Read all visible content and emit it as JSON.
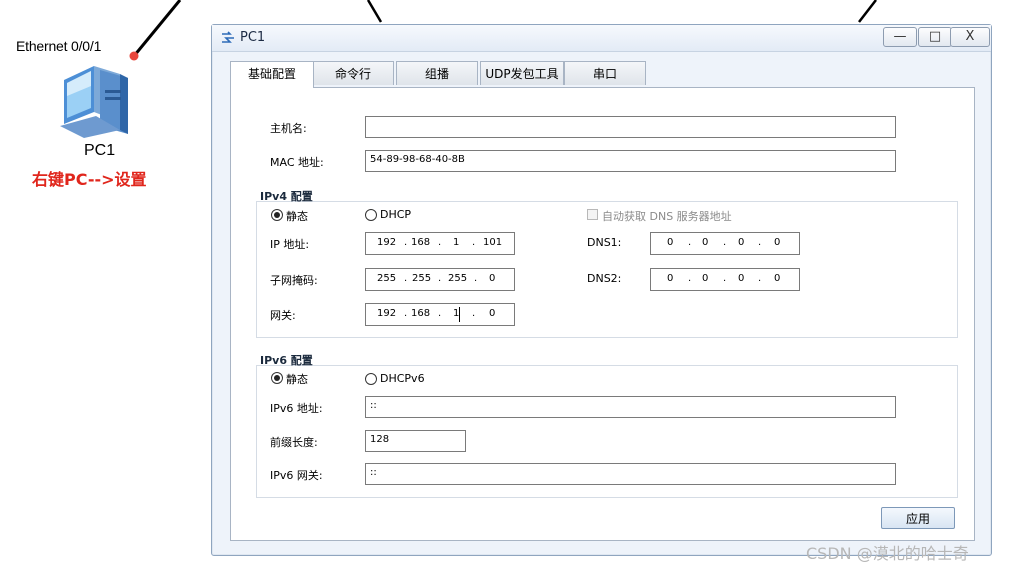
{
  "topology": {
    "port_label": "Ethernet 0/0/1",
    "device_name": "PC1",
    "hint_prefix": "右键",
    "hint_bold": "PC-->",
    "hint_suffix": "设置",
    "link_color": "#000000",
    "port_dot_color": "#e8463c",
    "hint_color": "#e0261c"
  },
  "window": {
    "title": "PC1",
    "minimize_label": "—",
    "maximize_label": "□",
    "close_label": "X"
  },
  "tabs": [
    {
      "label": "基础配置",
      "active": true
    },
    {
      "label": "命令行",
      "active": false
    },
    {
      "label": "组播",
      "active": false
    },
    {
      "label": "UDP发包工具",
      "active": false
    },
    {
      "label": "串口",
      "active": false
    }
  ],
  "basic": {
    "hostname_label": "主机名:",
    "hostname_value": "",
    "mac_label": "MAC 地址:",
    "mac_value": "54-89-98-68-40-8B"
  },
  "ipv4": {
    "section_title": "IPv4 配置",
    "static_label": "静态",
    "static_selected": true,
    "dhcp_label": "DHCP",
    "dhcp_selected": false,
    "auto_dns_label": "自动获取 DNS 服务器地址",
    "auto_dns_checked": false,
    "ip_label": "IP 地址:",
    "ip": [
      "192",
      "168",
      "1",
      "101"
    ],
    "mask_label": "子网掩码:",
    "mask": [
      "255",
      "255",
      "255",
      "0"
    ],
    "gateway_label": "网关:",
    "gateway": [
      "192",
      "168",
      "1",
      "0"
    ],
    "dns1_label": "DNS1:",
    "dns1": [
      "0",
      "0",
      "0",
      "0"
    ],
    "dns2_label": "DNS2:",
    "dns2": [
      "0",
      "0",
      "0",
      "0"
    ],
    "dot": "."
  },
  "ipv6": {
    "section_title": "IPv6 配置",
    "static_label": "静态",
    "static_selected": true,
    "dhcpv6_label": "DHCPv6",
    "dhcpv6_selected": false,
    "address_label": "IPv6 地址:",
    "address_value": "::",
    "prefix_label": "前缀长度:",
    "prefix_value": "128",
    "gateway_label": "IPv6 网关:",
    "gateway_value": "::"
  },
  "apply_label": "应用",
  "watermark": "CSDN @漠北的哈士奇"
}
